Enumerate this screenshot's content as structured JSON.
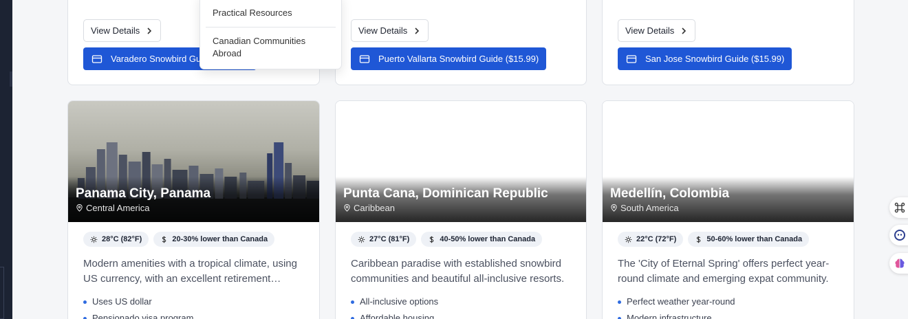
{
  "dropdown": {
    "items": [
      "Practical Resources",
      "Canadian Communities Abroad"
    ]
  },
  "top_cards": [
    {
      "details_label": "View Details",
      "guide_label": "Varadero Snowbird Guide ($15.99)"
    },
    {
      "details_label": "View Details",
      "guide_label": "Puerto Vallarta Snowbird Guide ($15.99)"
    },
    {
      "details_label": "View Details",
      "guide_label": "San Jose Snowbird Guide ($15.99)"
    }
  ],
  "destinations": [
    {
      "title": "Panama City, Panama",
      "region": "Central America",
      "temp": "28°C (82°F)",
      "cost": "20-30% lower than Canada",
      "description": "Modern amenities with a tropical climate, using US currency, with an excellent retirement…",
      "features": [
        "Uses US dollar",
        "Pensionado visa program"
      ]
    },
    {
      "title": "Punta Cana, Dominican Republic",
      "region": "Caribbean",
      "temp": "27°C (81°F)",
      "cost": "40-50% lower than Canada",
      "description": "Caribbean paradise with established snowbird communities and beautiful all-inclusive resorts.",
      "features": [
        "All-inclusive options",
        "Affordable housing"
      ]
    },
    {
      "title": "Medellín, Colombia",
      "region": "South America",
      "temp": "22°C (72°F)",
      "cost": "50-60% lower than Canada",
      "description": "The 'City of Eternal Spring' offers perfect year-round climate and emerging expat community.",
      "features": [
        "Perfect weather year-round",
        "Modern infrastructure"
      ]
    }
  ],
  "colors": {
    "primary_button": "#1f57d6",
    "feature_dot": "#2f6be0",
    "chip_bg": "#eef1f6"
  },
  "floating_icons": [
    "command-icon",
    "assistant-face-icon",
    "brain-icon"
  ]
}
